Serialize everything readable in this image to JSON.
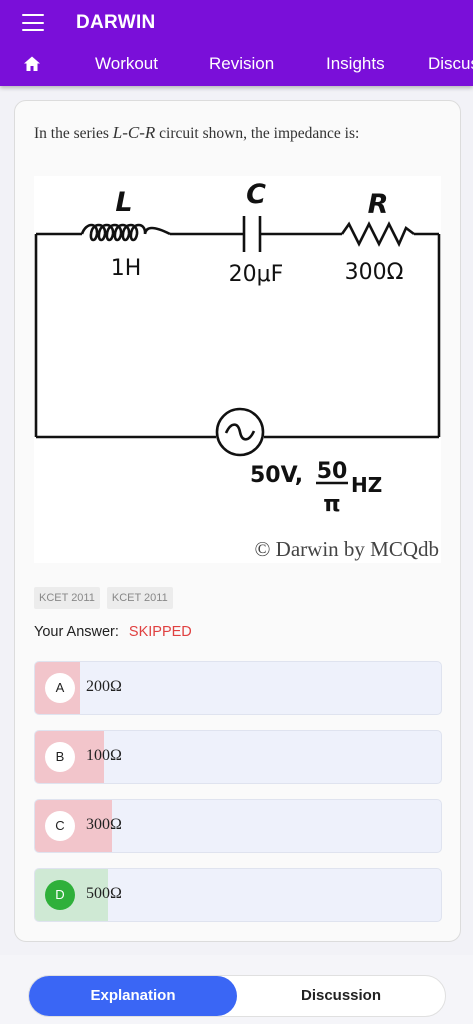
{
  "app": {
    "title": "DARWIN"
  },
  "nav": {
    "tabs": [
      {
        "label": "Workout"
      },
      {
        "label": "Revision"
      },
      {
        "label": "Insights"
      },
      {
        "label": "Discussion"
      }
    ]
  },
  "question": {
    "prefix": "In the series ",
    "circuit": "L-C-R",
    "suffix": " circuit shown, the impedance is:"
  },
  "figure": {
    "inductor_symbol": "L",
    "inductor_value": "1H",
    "capacitor_symbol": "C",
    "capacitor_value": "20μF",
    "resistor_symbol": "R",
    "resistor_value": "300Ω",
    "source_voltage": "50V,",
    "source_freq_num": "50",
    "source_freq_den": "π",
    "source_freq_unit": "HZ",
    "watermark": "© Darwin by MCQdb"
  },
  "tags": [
    "KCET 2011",
    "KCET 2011"
  ],
  "answer": {
    "label": "Your Answer:",
    "value": "SKIPPED"
  },
  "options": [
    {
      "letter": "A",
      "text": "200Ω",
      "fill": 0.11,
      "fill_color": "#f2c5cb",
      "correct": false
    },
    {
      "letter": "B",
      "text": "100Ω",
      "fill": 0.17,
      "fill_color": "#f2c5cb",
      "correct": false
    },
    {
      "letter": "C",
      "text": "300Ω",
      "fill": 0.19,
      "fill_color": "#f2c5cb",
      "correct": false
    },
    {
      "letter": "D",
      "text": "500Ω",
      "fill": 0.18,
      "fill_color": "#cfe9d4",
      "correct": true
    }
  ],
  "bottom": {
    "explanation": "Explanation",
    "discussion": "Discussion"
  },
  "colors": {
    "appbar": "#7a0fd9",
    "primary": "#3a66f5",
    "skipped": "#e04040",
    "correct": "#2fb03a"
  }
}
